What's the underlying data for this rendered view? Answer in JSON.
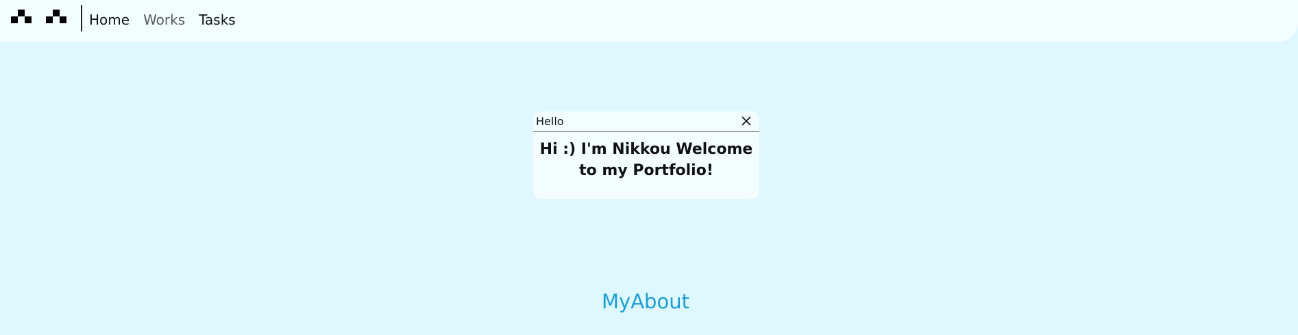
{
  "nav": {
    "items": [
      {
        "label": "Home"
      },
      {
        "label": "Works"
      },
      {
        "label": "Tasks"
      }
    ]
  },
  "dialog": {
    "title": "Hello",
    "message": "Hi :) I'm Nikkou Welcome to my Portfolio!",
    "close_icon": "close-icon"
  },
  "about_link": "MyAbout",
  "colors": {
    "page_background": "#dff7fe",
    "bar_background": "#f3fcff",
    "link_accent": "#1a9fd6"
  }
}
